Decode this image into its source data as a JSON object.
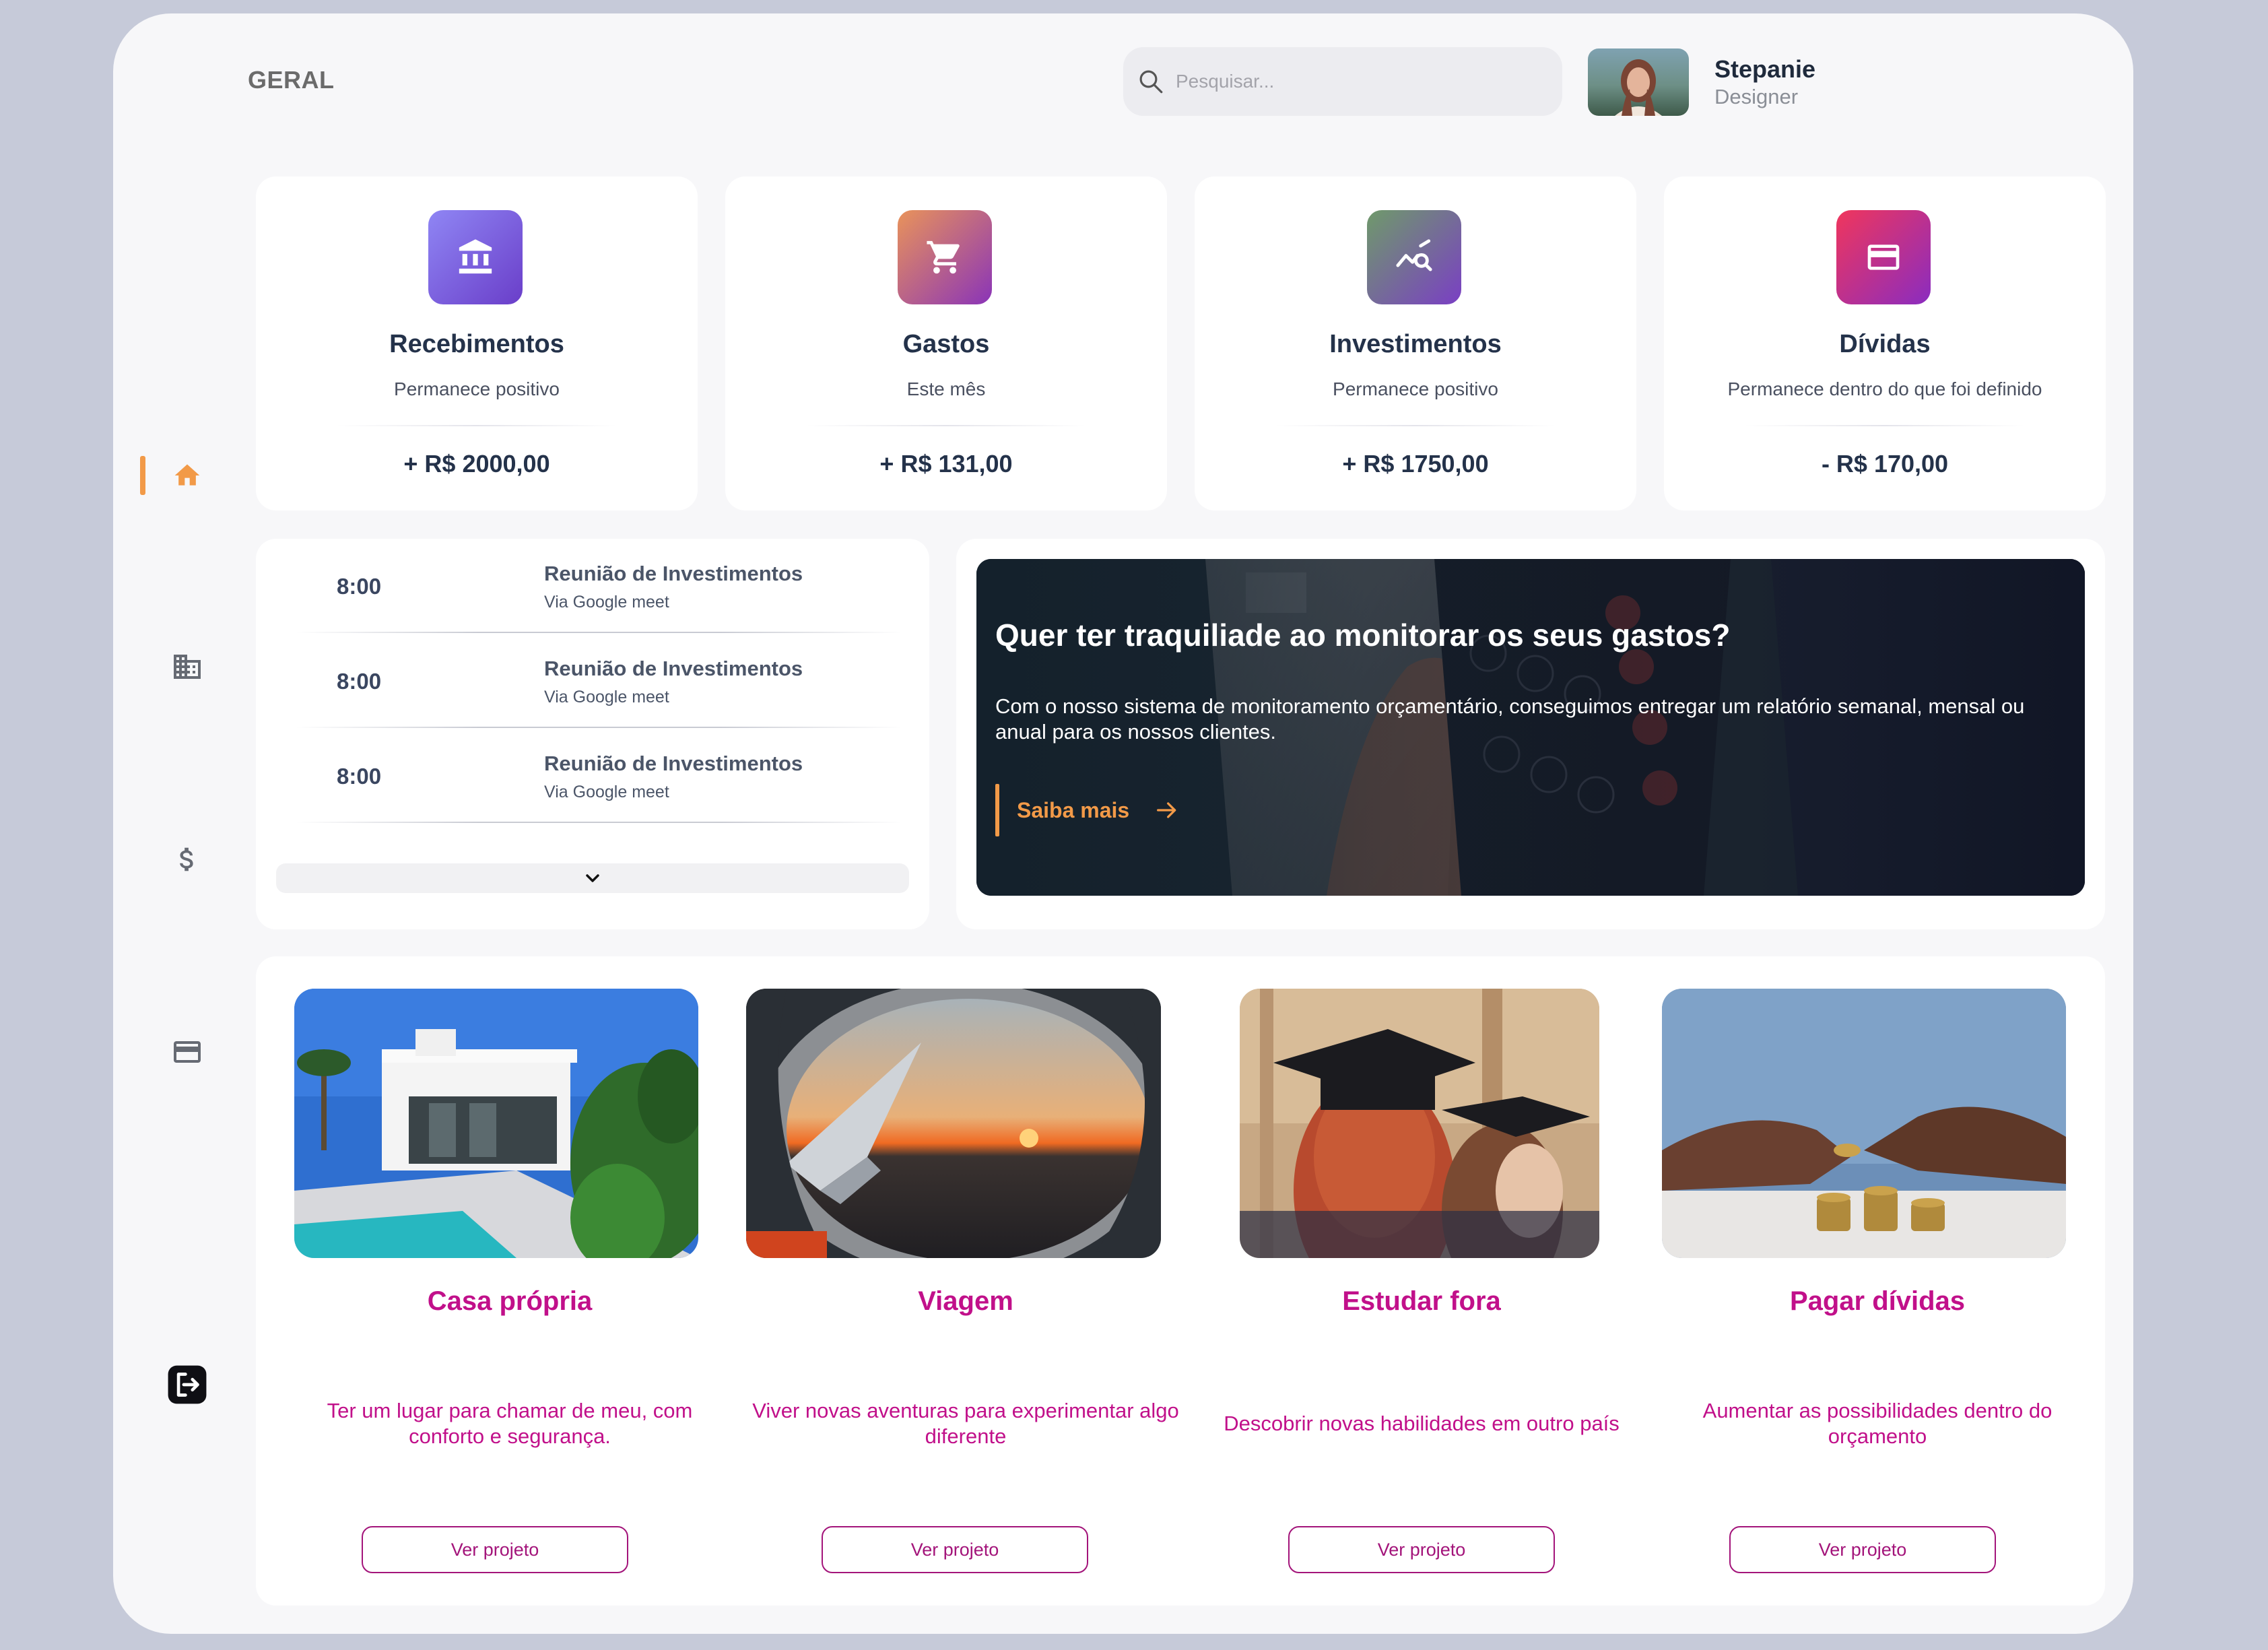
{
  "header": {
    "title": "GERAL",
    "search_placeholder": "Pesquisar...",
    "user": {
      "name": "Stepanie",
      "role": "Designer"
    }
  },
  "sidebar": {
    "active": "home",
    "items": [
      {
        "id": "home",
        "icon": "home-icon"
      },
      {
        "id": "buildings",
        "icon": "building-icon"
      },
      {
        "id": "finance",
        "icon": "dollar-icon"
      },
      {
        "id": "cards",
        "icon": "credit-card-icon"
      },
      {
        "id": "logout",
        "icon": "logout-icon"
      }
    ]
  },
  "stats": [
    {
      "title": "Recebimentos",
      "subtitle": "Permanece positivo",
      "value": "+ R$ 2000,00",
      "icon": "bank-icon"
    },
    {
      "title": "Gastos",
      "subtitle": "Este mês",
      "value": "+ R$ 131,00",
      "icon": "cart-icon"
    },
    {
      "title": "Investimentos",
      "subtitle": "Permanece positivo",
      "value": "+ R$ 1750,00",
      "icon": "chart-search-icon"
    },
    {
      "title": "Dívidas",
      "subtitle": "Permanece dentro do que foi definido",
      "value": "- R$ 170,00",
      "icon": "credit-card-icon"
    }
  ],
  "agenda": [
    {
      "time": "8:00",
      "title": "Reunião de Investimentos",
      "subtitle": "Via Google meet"
    },
    {
      "time": "8:00",
      "title": "Reunião de Investimentos",
      "subtitle": "Via Google meet"
    },
    {
      "time": "8:00",
      "title": "Reunião de Investimentos",
      "subtitle": "Via Google meet"
    }
  ],
  "hero": {
    "title": "Quer ter traquiliade ao monitorar os seus gastos?",
    "text": "Com o nosso sistema de monitoramento orçamentário, conseguimos entregar um relatório semanal, mensal ou anual para os nossos clientes.",
    "cta": "Saiba mais"
  },
  "projects": [
    {
      "title": "Casa própria",
      "description": "Ter um lugar para chamar de meu, com conforto e segurança.",
      "button": "Ver projeto"
    },
    {
      "title": "Viagem",
      "description": "Viver novas aventuras para experimentar algo diferente",
      "button": "Ver projeto"
    },
    {
      "title": "Estudar fora",
      "description": "Descobrir novas habilidades em outro país",
      "button": "Ver projeto"
    },
    {
      "title": "Pagar dívidas",
      "description": "Aumentar as possibilidades dentro do orçamento",
      "button": "Ver projeto"
    }
  ],
  "colors": {
    "accent_orange": "#f29a48",
    "project_magenta": "#c1108a",
    "page_background": "#c6cad9"
  }
}
